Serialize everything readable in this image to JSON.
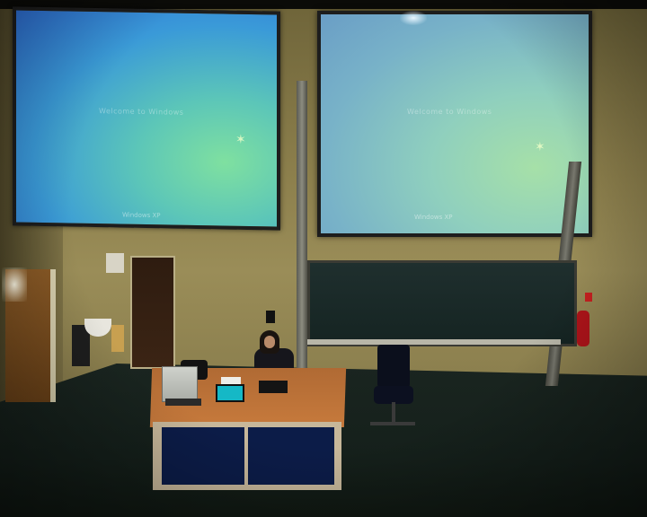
{
  "scene": {
    "screen_left": {
      "text": "Welcome to Windows",
      "logo": "Windows XP"
    },
    "screen_right": {
      "text": "Welcome to Windows",
      "logo": "Windows XP"
    },
    "colors": {
      "wall": "#8c7f4c",
      "floor": "#15201b",
      "desk_top": "#c77a3c",
      "desk_panel": "#0c1c48",
      "blackboard": "#1f2f2e",
      "extinguisher": "#b0141a"
    }
  }
}
